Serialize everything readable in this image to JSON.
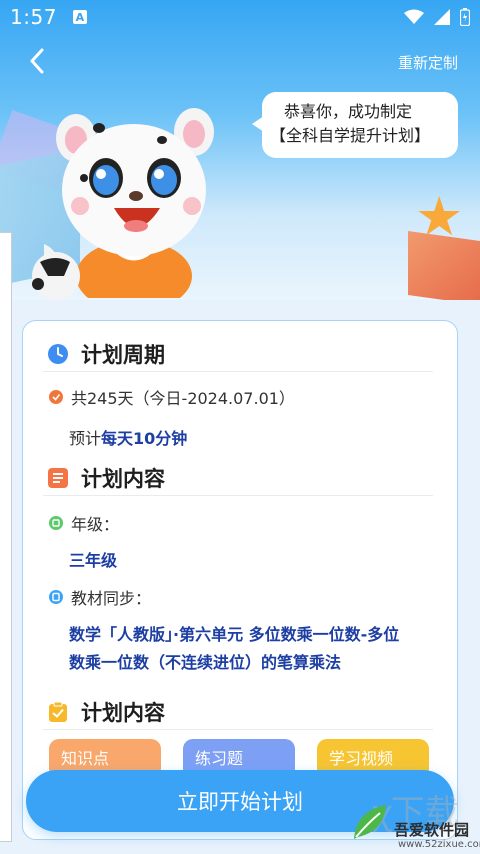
{
  "status": {
    "time": "1:57",
    "notif": "A"
  },
  "header": {
    "reset_label": "重新定制",
    "bubble_line1": "恭喜你，成功制定",
    "bubble_line2": "【全科自学提升计划】"
  },
  "period": {
    "title": "计划周期",
    "days_text": "共245天（今日-2024.07.01）",
    "estimate_prefix": "预计",
    "estimate_value": "每天10分钟"
  },
  "content": {
    "title": "计划内容",
    "grade_label": "年级：",
    "grade_value": "三年级",
    "textbook_label": "教材同步：",
    "textbook_line1": "数学「人教版」·第六单元 多位数乘一位数-多位",
    "textbook_line2": "数乘一位数（不连续进位）的笔算乘法"
  },
  "content2": {
    "title": "计划内容",
    "tags": [
      "知识点",
      "练习题",
      "学习视频"
    ]
  },
  "start_button": "立即开始计划",
  "watermark": {
    "name": "吾爱软件园",
    "url": "www.52zixue.com"
  },
  "colors": {
    "accent": "#3aa3f6",
    "tag_orange": "#f9a76a",
    "tag_blue": "#7da0f5",
    "tag_yellow": "#f7c531"
  }
}
